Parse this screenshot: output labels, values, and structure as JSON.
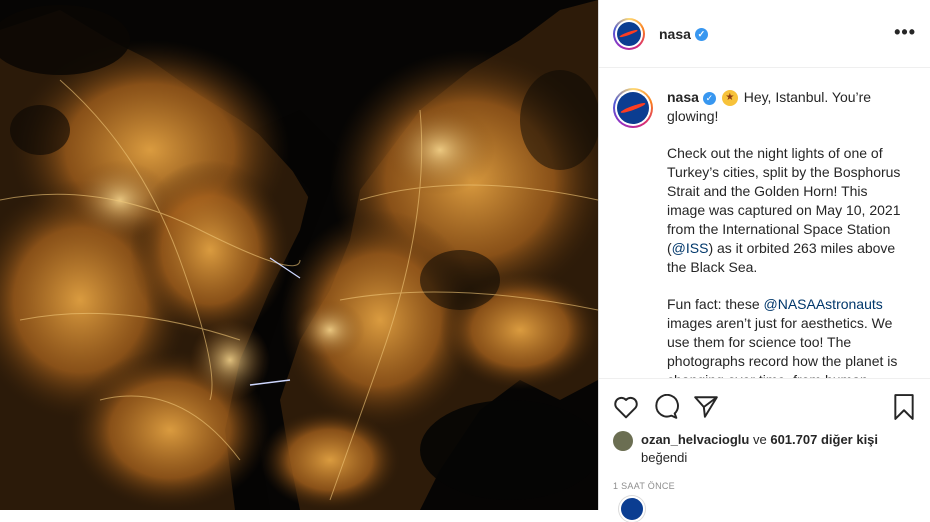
{
  "post": {
    "username": "nasa",
    "header_more": "•••",
    "caption_line1": "Hey, Istanbul. You’re glowing!",
    "caption_p2": "Check out the night lights of one of Turkey’s cities, split by the Bosphorus Strait and the Golden Horn! This image was captured on May 10, 2021 from the International Space Station (",
    "caption_mention_iss": "@ISS",
    "caption_p2_end": ") as it orbited 263 miles above the Black Sea.",
    "caption_p3_start": "Fun fact: these ",
    "caption_mention_astronauts": "@NASAAstronauts",
    "caption_p3_end": " images aren’t just for aesthetics. We use them for science too! The photographs record how the planet is changing over time, from human"
  },
  "likes": {
    "liker": "ozan_helvacioglu",
    "connector": " ve ",
    "others": "601.707 diğer kişi",
    "suffix": "beğendi"
  },
  "timestamp": "1 SAAT ÖNCE",
  "colors": {
    "accent": "#3897f0",
    "link": "#00376b",
    "city_light": "#d58a2e"
  }
}
